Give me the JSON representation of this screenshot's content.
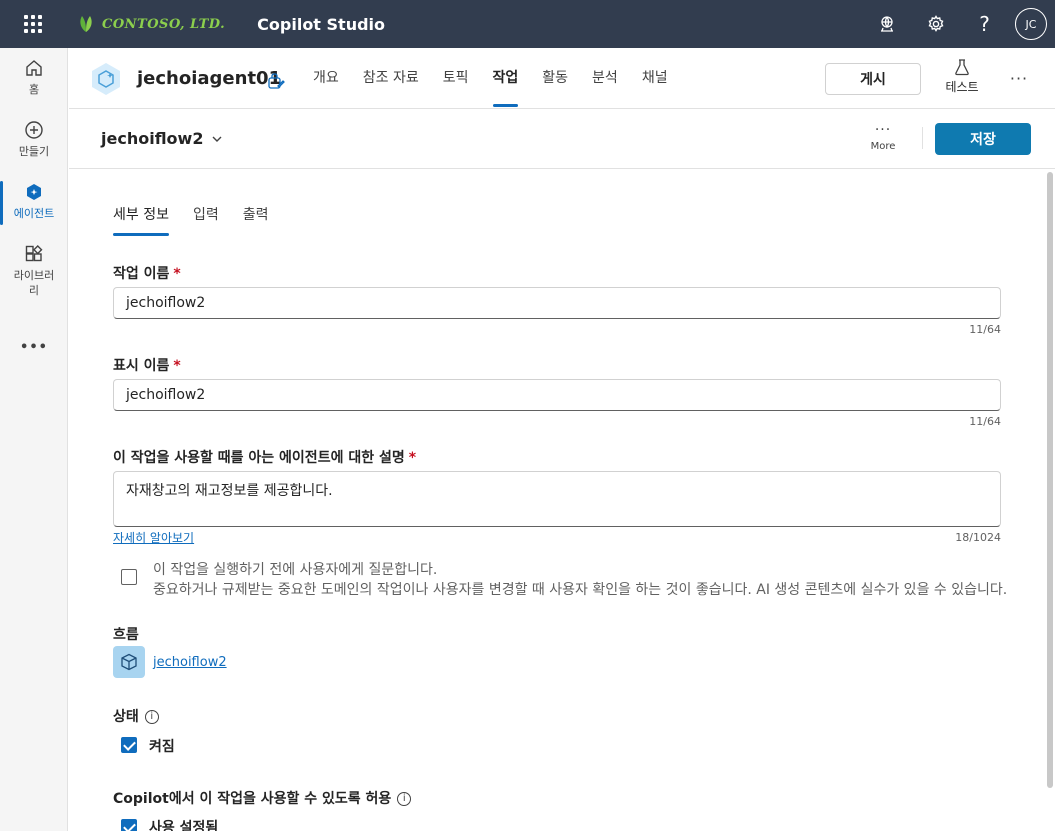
{
  "topbar": {
    "company": "CONTOSO, LTD.",
    "product": "Copilot Studio",
    "avatar_initials": "JC",
    "icons": [
      "waffle-icon",
      "environment-icon",
      "settings-icon",
      "help-icon"
    ]
  },
  "rail": {
    "items": [
      {
        "label": "홈",
        "icon": "home-icon"
      },
      {
        "label": "만들기",
        "icon": "add-circle-icon"
      },
      {
        "label": "에이전트",
        "icon": "agent-icon"
      },
      {
        "label": "라이브러\n리",
        "icon": "library-icon"
      }
    ],
    "more": "•••"
  },
  "agent": {
    "name": "jechoiagent01",
    "tabs": [
      "개요",
      "참조 자료",
      "토픽",
      "작업",
      "활동",
      "분석",
      "채널"
    ],
    "active_tab": "작업",
    "publish_label": "게시",
    "test_label": "테스트",
    "more": "···"
  },
  "flow_header": {
    "title": "jechoiflow2",
    "more_label": "More",
    "more_dots": "···",
    "save_label": "저장"
  },
  "content": {
    "tabs": [
      "세부 정보",
      "입력",
      "출력"
    ],
    "action_name": {
      "label": "작업 이름",
      "value": "jechoiflow2",
      "counter": "11/64"
    },
    "display_name": {
      "label": "표시 이름",
      "value": "jechoiflow2",
      "counter": "11/64"
    },
    "description": {
      "label": "이 작업을 사용할 때를 아는 에이전트에 대한 설명",
      "value": "자재창고의 재고정보를 제공합니다.",
      "counter": "18/1024",
      "learn_more": "자세히 알아보기"
    },
    "ask_user": {
      "checked": false,
      "title": "이 작업을 실행하기 전에 사용자에게 질문합니다.",
      "description": "중요하거나 규제받는 중요한 도메인의 작업이나 사용자를 변경할 때 사용자 확인을 하는 것이 좋습니다. AI 생성 콘텐츠에 실수가 있을 수 있습니다."
    },
    "flow": {
      "label": "흐름",
      "link": "jechoiflow2"
    },
    "status": {
      "label": "상태",
      "checkbox_label": "켜짐",
      "checked": true
    },
    "copilot_allow": {
      "label": "Copilot에서 이 작업을 사용할 수 있도록 허용",
      "checkbox_label": "사용 설정됨",
      "checked": true
    },
    "required_mark": "*",
    "info_glyph": "i"
  },
  "colors": {
    "topbar": "#323d4f",
    "accent": "#0f6cbd",
    "save": "#0f7ab0",
    "brand_green": "#8ccf4d"
  }
}
